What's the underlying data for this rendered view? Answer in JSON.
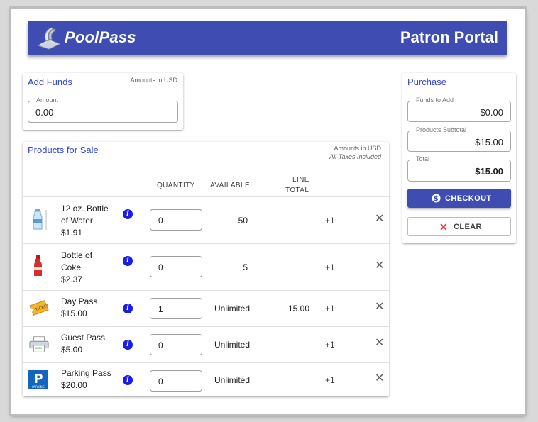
{
  "header": {
    "brand": "PoolPass",
    "portal_title": "Patron Portal"
  },
  "add_funds": {
    "title": "Add Funds",
    "currency_note": "Amounts in USD",
    "amount_label": "Amount",
    "amount_value": "0.00"
  },
  "products": {
    "title": "Products for Sale",
    "currency_note": "Amounts in USD",
    "tax_note": "All Taxes Included",
    "columns": {
      "quantity": "QUANTITY",
      "available": "AVAILABLE",
      "line_total_1": "LINE",
      "line_total_2": "TOTAL"
    },
    "items": [
      {
        "name_1": "12 oz. Bottle",
        "name_2": "of Water",
        "price": "$1.91",
        "qty": "0",
        "available": "50",
        "line_total": "",
        "increment": "+1",
        "icon": "water-bottle-icon"
      },
      {
        "name_1": "Bottle of",
        "name_2": "Coke",
        "price": "$2.37",
        "qty": "0",
        "available": "5",
        "line_total": "",
        "increment": "+1",
        "icon": "coke-bottle-icon"
      },
      {
        "name_1": "Day Pass",
        "price": "$15.00",
        "qty": "1",
        "available": "Unlimited",
        "line_total": "15.00",
        "increment": "+1",
        "icon": "ticket-icon"
      },
      {
        "name_1": "Guest Pass",
        "price": "$5.00",
        "qty": "0",
        "available": "Unlimited",
        "line_total": "",
        "increment": "+1",
        "icon": "printer-pass-icon"
      },
      {
        "name_1": "Parking Pass",
        "price": "$20.00",
        "qty": "0",
        "available": "Unlimited",
        "line_total": "",
        "increment": "+1",
        "icon": "parking-icon"
      }
    ]
  },
  "purchase": {
    "title": "Purchase",
    "funds_label": "Funds to Add",
    "funds_value": "$0.00",
    "subtotal_label": "Products Subtotal",
    "subtotal_value": "$15.00",
    "total_label": "Total",
    "total_value": "$15.00",
    "checkout_label": "CHECKOUT",
    "clear_label": "CLEAR"
  },
  "colors": {
    "primary": "#3f4db3",
    "link": "#3547c8",
    "info": "#1a1de8",
    "clear_x": "#e53935"
  }
}
